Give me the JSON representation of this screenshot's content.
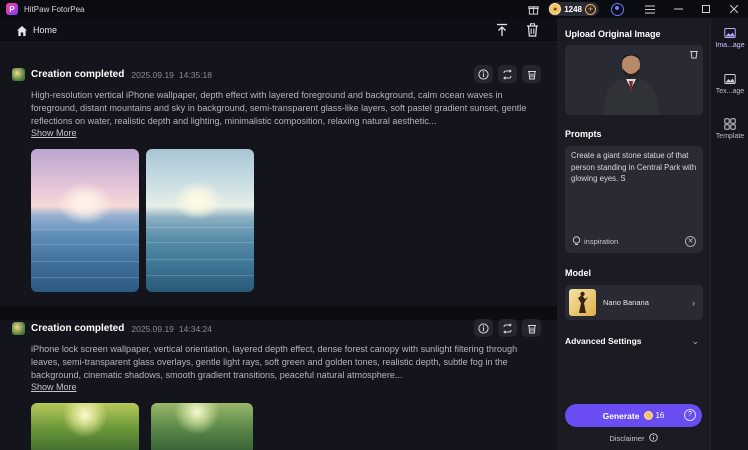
{
  "app": {
    "title": "HitPaw FotorPea",
    "logo_letter": "P",
    "credits": "1248"
  },
  "toolbar": {
    "home_label": "Home"
  },
  "feed": {
    "cards": [
      {
        "title": "Creation completed",
        "date": "2025.09.19",
        "time": "14:35:18",
        "prompt": "High-resolution vertical iPhone wallpaper, depth effect with layered foreground and background, calm ocean waves in foreground, distant mountains and sky in background, semi-transparent glass-like layers, soft pastel gradient sunset, gentle reflections on water, realistic depth and lighting, minimalistic composition, relaxing natural aesthetic...",
        "show_more": "Show More"
      },
      {
        "title": "Creation completed",
        "date": "2025.09.19",
        "time": "14:34:24",
        "prompt": "iPhone lock screen wallpaper, vertical orientation, layered depth effect, dense forest canopy with sunlight filtering through leaves, semi-transparent glass overlays, gentle light rays, soft green and golden tones, realistic depth, subtle fog in the background, cinematic shadows, smooth gradient transitions, peaceful natural atmosphere...",
        "show_more": "Show More"
      }
    ]
  },
  "panel": {
    "upload_label": "Upload Original Image",
    "prompts_label": "Prompts",
    "prompt_value": "Create a giant stone statue of that person standing in Central Park with glowing eyes. S",
    "inspiration_label": "inspiration",
    "model_label": "Model",
    "model_name": "Nano Banana",
    "advanced_label": "Advanced Settings",
    "generate_label": "Generate",
    "generate_cost": "16",
    "disclaimer": "Disclaimer"
  },
  "tabs": [
    {
      "label": "Ima...age",
      "active": true
    },
    {
      "label": "Tex...age",
      "active": false
    },
    {
      "label": "Template",
      "active": false
    }
  ],
  "colors": {
    "accent": "#6a4df2",
    "background": "#0e0e16",
    "panel": "#1b1b24"
  }
}
